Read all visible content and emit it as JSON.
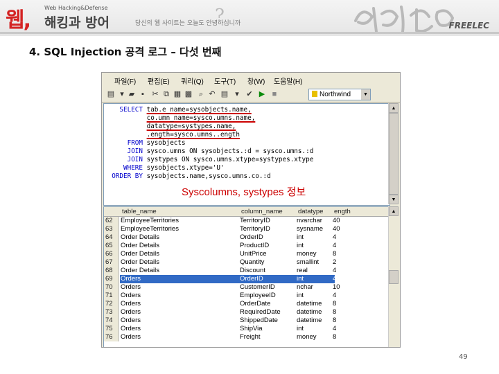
{
  "header": {
    "logo_web": "웹,",
    "logo_small": "Web Hacking&Defense",
    "logo_main": "해킹과 방어",
    "slogan": "당신의 웹 사이트는 오늘도 안녕하십니까",
    "question_mark": "?",
    "publisher": "FREELEC",
    "brand_color": "#d42323"
  },
  "slide": {
    "title": "4. SQL Injection 공격 로그 – 다섯 번째",
    "page_number": "49"
  },
  "window": {
    "menu": [
      "파일(F)",
      "편집(E)",
      "쿼리(Q)",
      "도구(T)",
      "창(W)",
      "도움말(H)"
    ],
    "toolbar_icons": [
      "sql-file-icon",
      "new-icon",
      "open-icon",
      "save-icon",
      "cut-icon",
      "copy-icon",
      "paste-icon",
      "clear-icon",
      "find-icon",
      "undo-icon",
      "mode-icon",
      "execute-check-icon",
      "execute-icon",
      "stop-icon"
    ],
    "database": "Northwind"
  },
  "sql": {
    "lines": [
      [
        "SELECT",
        "tab.e_name=sysobjects.name,"
      ],
      [
        "",
        "co.umn_name=sysco.umns.name,"
      ],
      [
        "",
        "datatype=systypes.name,"
      ],
      [
        "",
        ".ength=sysco.umns..ength"
      ],
      [
        "FROM",
        "sysobjects"
      ],
      [
        "JOIN",
        "sysco.umns ON sysobjects.:d = sysco.umns.:d"
      ],
      [
        "JOIN",
        "systypes ON sysco.umns.xtype=systypes.xtype"
      ],
      [
        "WHERE",
        "sysobjects.xtype='U'"
      ],
      [
        "ORDER BY",
        "sysobjects.name,sysco.umns.co.:d"
      ]
    ],
    "annotation": "Syscolumns, systypes 정보"
  },
  "results": {
    "columns": [
      "table_name",
      "column_name",
      "datatype",
      "ength"
    ],
    "rows": [
      [
        "62",
        "EmployeeTerritories",
        "TerritoryID",
        "nvarchar",
        "40"
      ],
      [
        "63",
        "EmployeeTerritories",
        "TerritoryID",
        "sysname",
        "40"
      ],
      [
        "64",
        "Order Details",
        "OrderID",
        "int",
        "4"
      ],
      [
        "65",
        "Order Details",
        "ProductID",
        "int",
        "4"
      ],
      [
        "66",
        "Order Details",
        "UnitPrice",
        "money",
        "8"
      ],
      [
        "67",
        "Order Details",
        "Quantity",
        "smallint",
        "2"
      ],
      [
        "68",
        "Order Details",
        "Discount",
        "real",
        "4"
      ],
      [
        "69",
        "Orders",
        "OrderID",
        "int",
        "4"
      ],
      [
        "70",
        "Orders",
        "CustomerID",
        "nchar",
        "10"
      ],
      [
        "71",
        "Orders",
        "EmployeeID",
        "int",
        "4"
      ],
      [
        "72",
        "Orders",
        "OrderDate",
        "datetime",
        "8"
      ],
      [
        "73",
        "Orders",
        "RequiredDate",
        "datetime",
        "8"
      ],
      [
        "74",
        "Orders",
        "ShippedDate",
        "datetime",
        "8"
      ],
      [
        "75",
        "Orders",
        "ShipVia",
        "int",
        "4"
      ],
      [
        "76",
        "Orders",
        "Freight",
        "money",
        "8"
      ]
    ],
    "selected_row": "69"
  }
}
